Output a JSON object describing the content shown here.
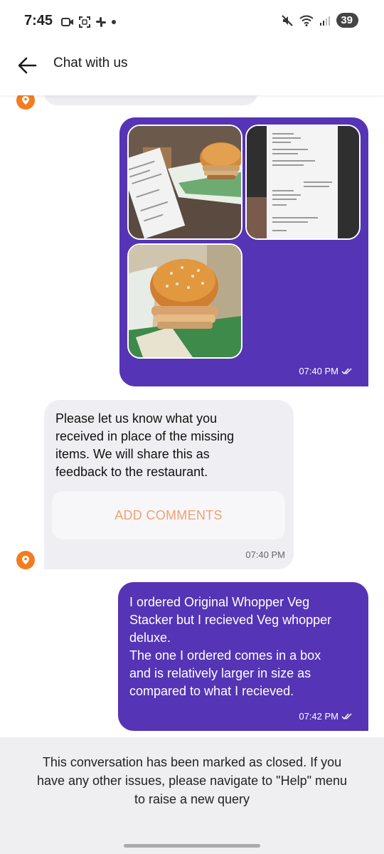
{
  "status_bar": {
    "time": "7:45",
    "battery": "39"
  },
  "header": {
    "title": "Chat with us"
  },
  "messages": {
    "images_time": "07:40 PM",
    "bot_message": {
      "lines": [
        "Please let us know what you",
        "received in place of the missing",
        "items. We will share this as",
        "feedback to the restaurant."
      ],
      "button_label": "ADD COMMENTS",
      "time": "07:40 PM"
    },
    "user_message": {
      "lines": [
        "I ordered Original Whopper Veg",
        "Stacker but I recieved Veg whopper",
        "deluxe.",
        "The one I ordered comes in a box",
        "and is relatively larger in size as",
        "compared to what I recieved."
      ],
      "time": "07:42 PM"
    }
  },
  "closed_banner": {
    "lines": [
      "This conversation has been marked as closed. If you",
      "have any other issues, please navigate to \"Help\" menu",
      "to raise a new query"
    ]
  },
  "colors": {
    "accent_purple": "#5534b5",
    "brand_orange": "#f47c20",
    "bot_bubble": "#efeff3"
  }
}
